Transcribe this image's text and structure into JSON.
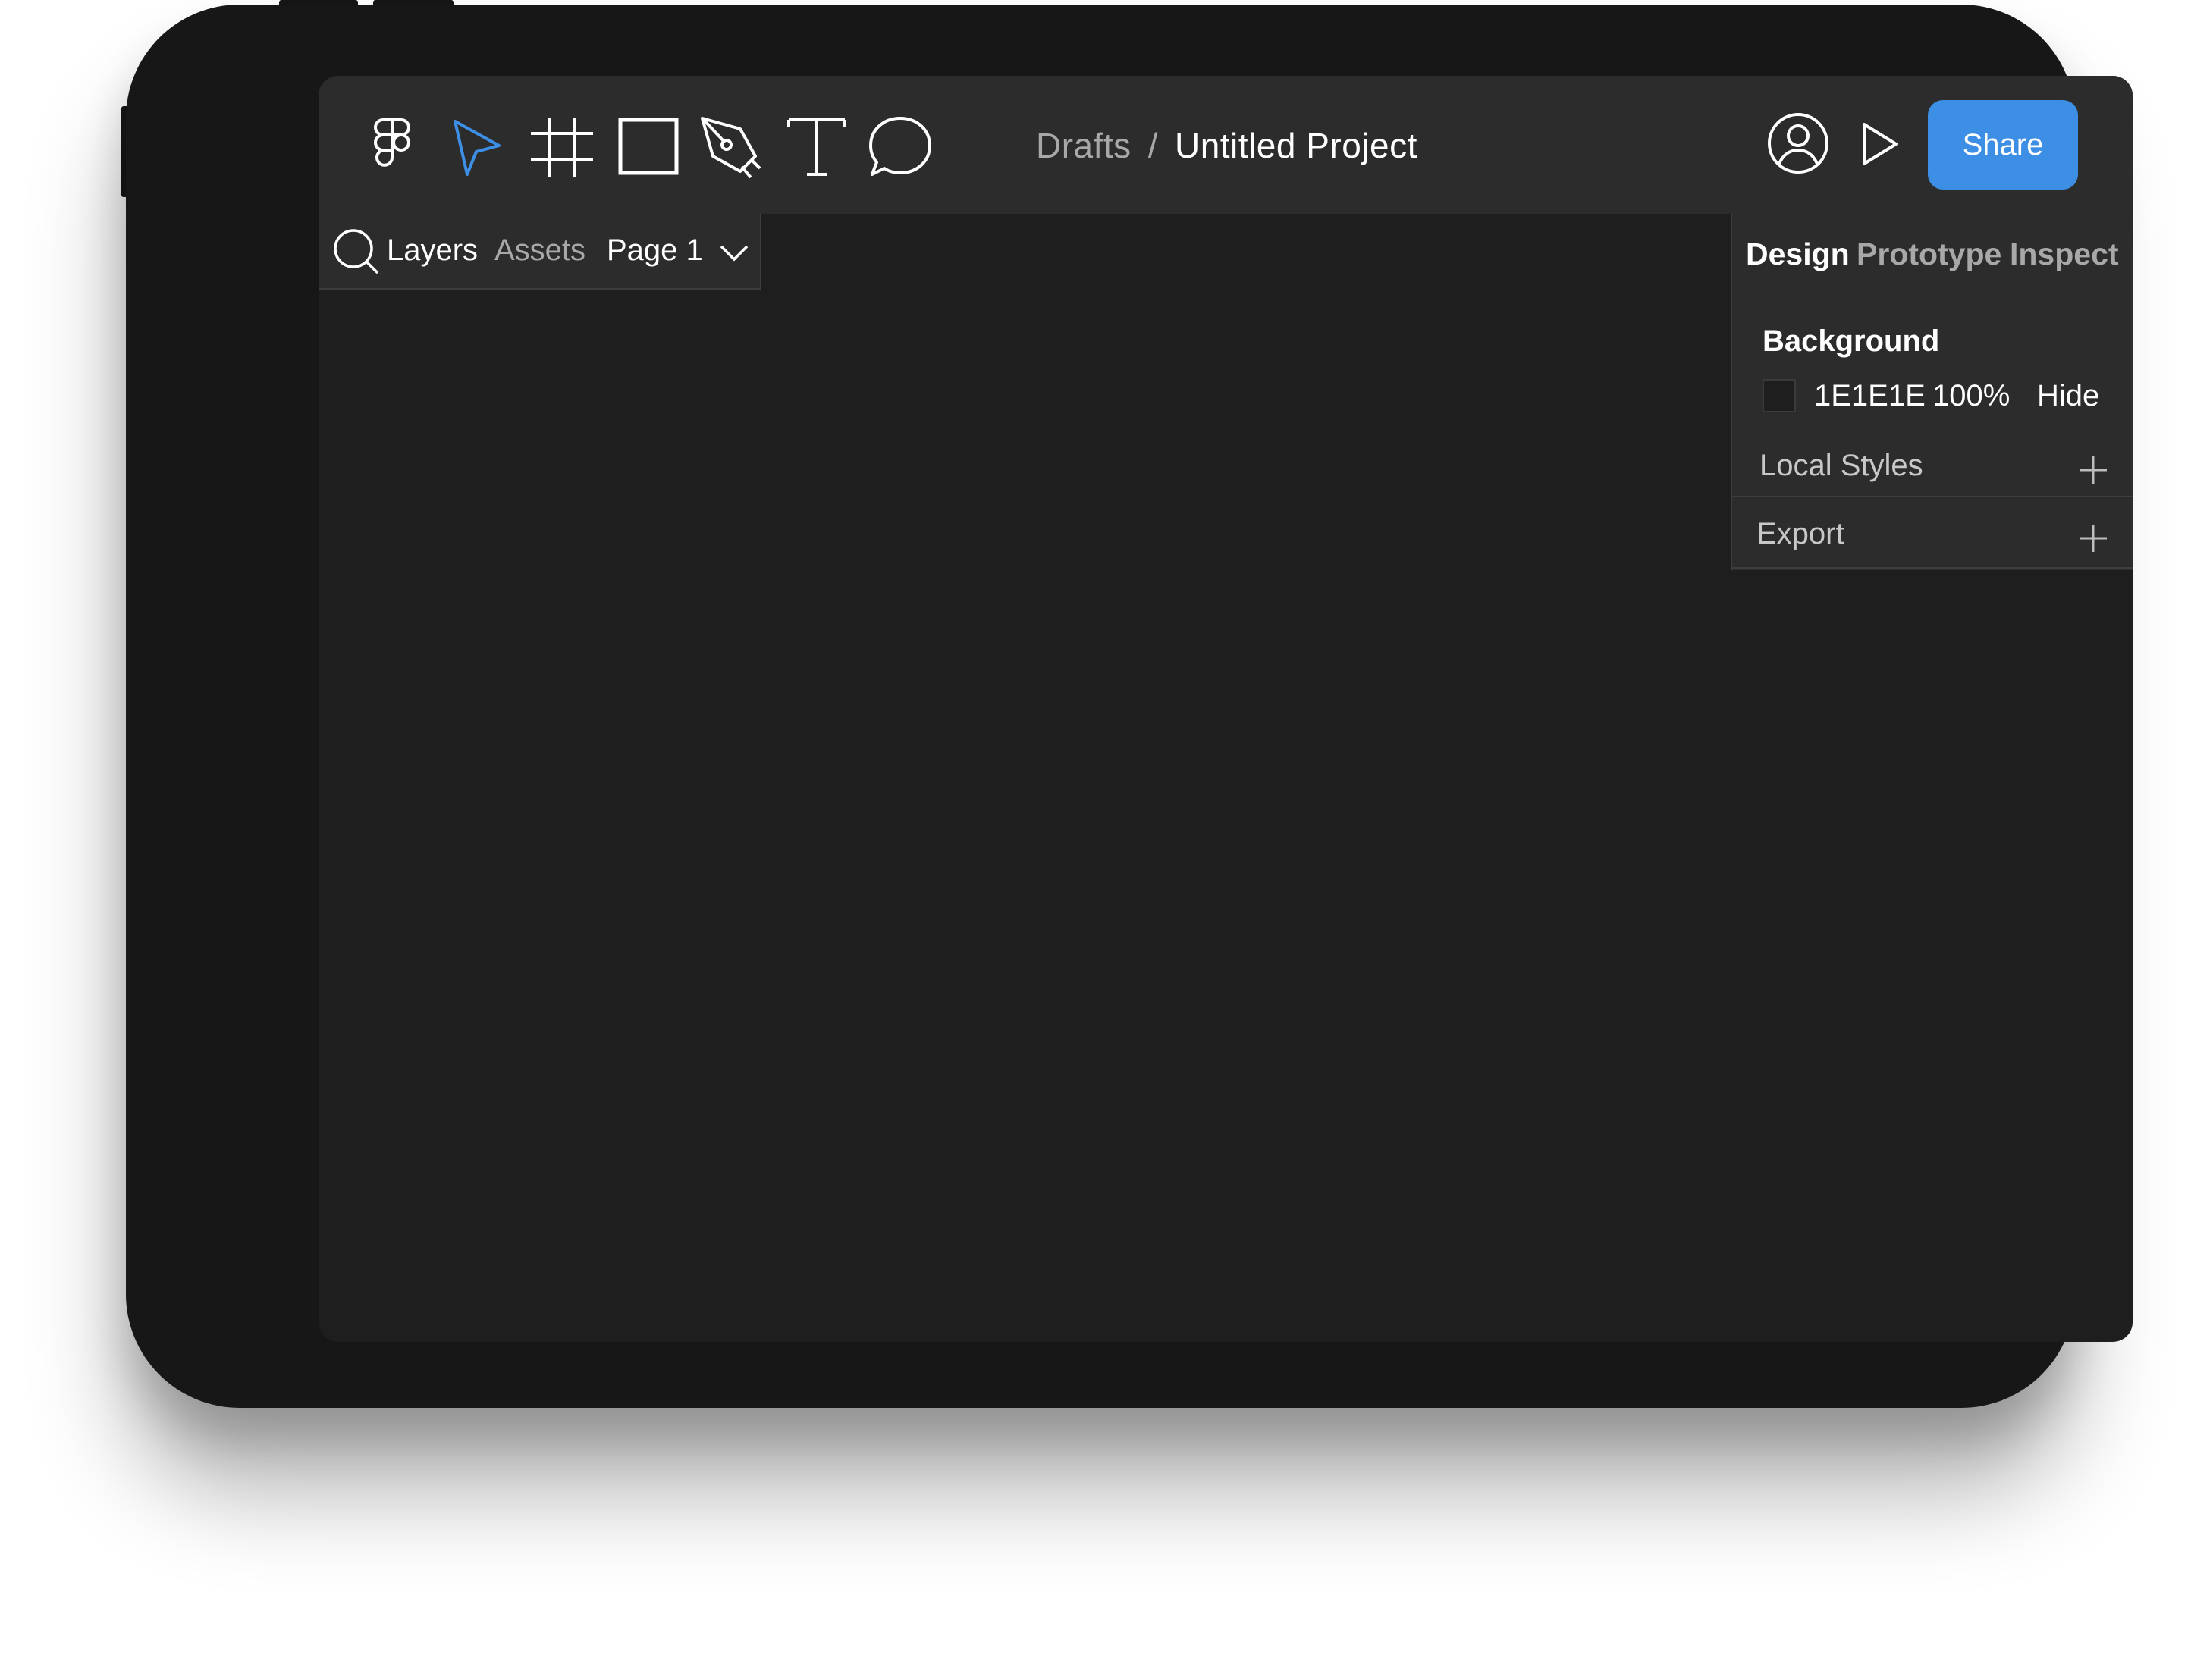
{
  "toolbar": {
    "tools": [
      "figma-logo-icon",
      "move-cursor-icon",
      "frame-icon",
      "rectangle-icon",
      "pen-icon",
      "text-icon",
      "comment-icon"
    ],
    "breadcrumb": {
      "root": "Drafts",
      "separator": "/",
      "project": "Untitled Project"
    },
    "right_icons": [
      "user-icon",
      "play-icon"
    ],
    "share_label": "Share"
  },
  "left_panel": {
    "search_icon": "search-icon",
    "tabs": [
      "Layers",
      "Assets"
    ],
    "page_select": "Page 1"
  },
  "right_panel": {
    "tabs": [
      "Design",
      "Prototype",
      "Inspect"
    ],
    "background": {
      "heading": "Background",
      "hex": "1E1E1E",
      "opacity": "100%",
      "visibility_action": "Hide"
    },
    "sections": [
      "Local Styles",
      "Export"
    ]
  },
  "colors": {
    "accent": "#3d8fe6",
    "toolbar_bg": "#2c2c2c",
    "canvas_bg": "#1e1e1e",
    "device_frame": "#171717"
  }
}
